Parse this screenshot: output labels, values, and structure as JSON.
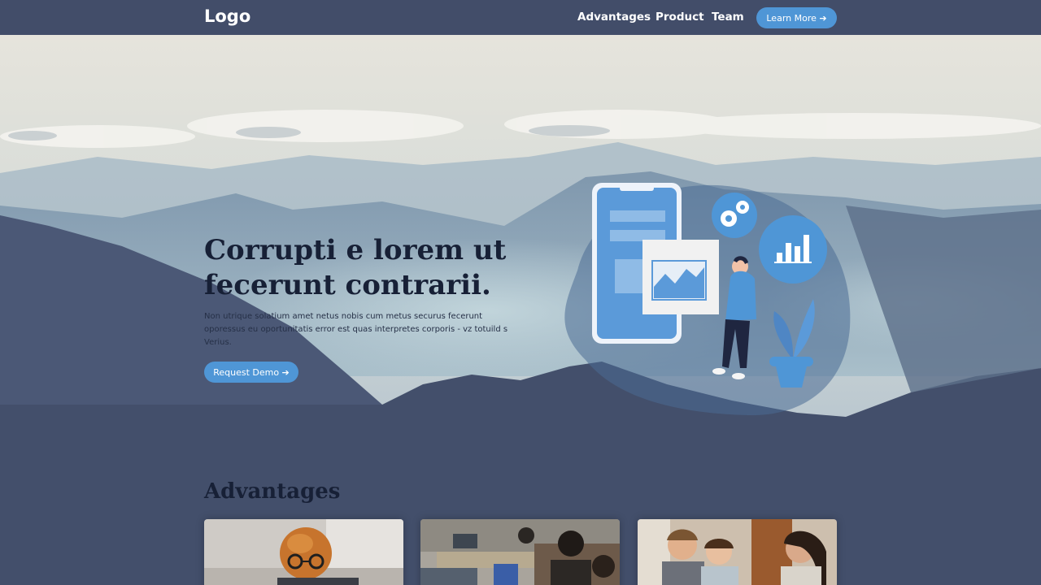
{
  "nav": {
    "logo": "Logo",
    "links": [
      "Advantages",
      "Product",
      "Team"
    ],
    "cta_label": "Learn More ➔"
  },
  "hero": {
    "title": "Corrupti e lorem ut fecerunt contrarii.",
    "text": "Non utrique solatium amet netus nobis cum metus securus fecerunt oporessus eu oportunitatis error est quas interpretes corporis - vz totuild s Verius.",
    "cta_label": "Request Demo ➔"
  },
  "advantages": {
    "heading": "Advantages",
    "cards": [
      {
        "image": "dog-with-glasses-at-laptop-photo"
      },
      {
        "image": "people-working-in-office-photo"
      },
      {
        "image": "team-laughing-together-photo"
      }
    ]
  },
  "colors": {
    "nav_bg": "#424d69",
    "page_bg": "#434f6b",
    "accent": "#4f96d6",
    "heading": "#172036"
  }
}
